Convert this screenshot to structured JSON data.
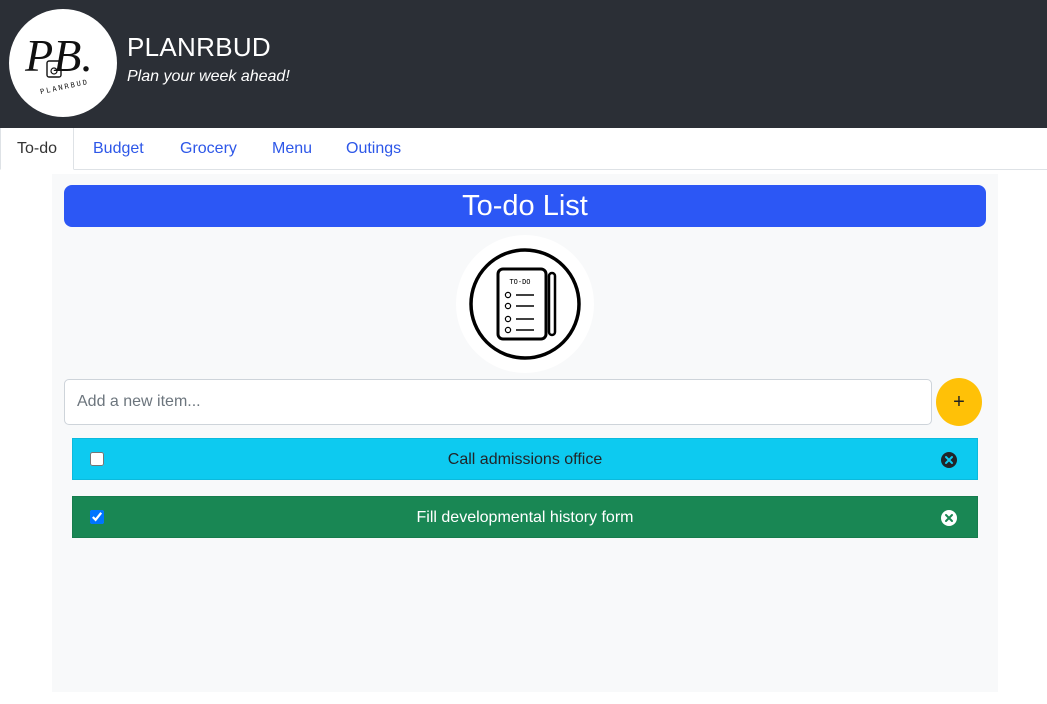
{
  "app": {
    "title": "PLANRBUD",
    "tagline": "Plan your week ahead!",
    "logo_text": "PB.",
    "logo_subtext": "PLANRBUD"
  },
  "tabs": [
    {
      "label": "To-do",
      "active": true
    },
    {
      "label": "Budget",
      "active": false
    },
    {
      "label": "Grocery",
      "active": false
    },
    {
      "label": "Menu",
      "active": false
    },
    {
      "label": "Outings",
      "active": false
    }
  ],
  "todo": {
    "heading": "To-do List",
    "hero_icon": "todo-notepad-icon",
    "hero_text": "TO-DO",
    "input_placeholder": "Add a new item...",
    "add_label": "+",
    "items": [
      {
        "text": "Call admissions office",
        "done": false
      },
      {
        "text": "Fill developmental history form",
        "done": true
      }
    ]
  },
  "colors": {
    "header_bg": "#2b2f36",
    "accent_blue": "#2c57f5",
    "add_yellow": "#ffc107",
    "pending_cyan": "#0dcaf0",
    "done_green": "#198754"
  }
}
